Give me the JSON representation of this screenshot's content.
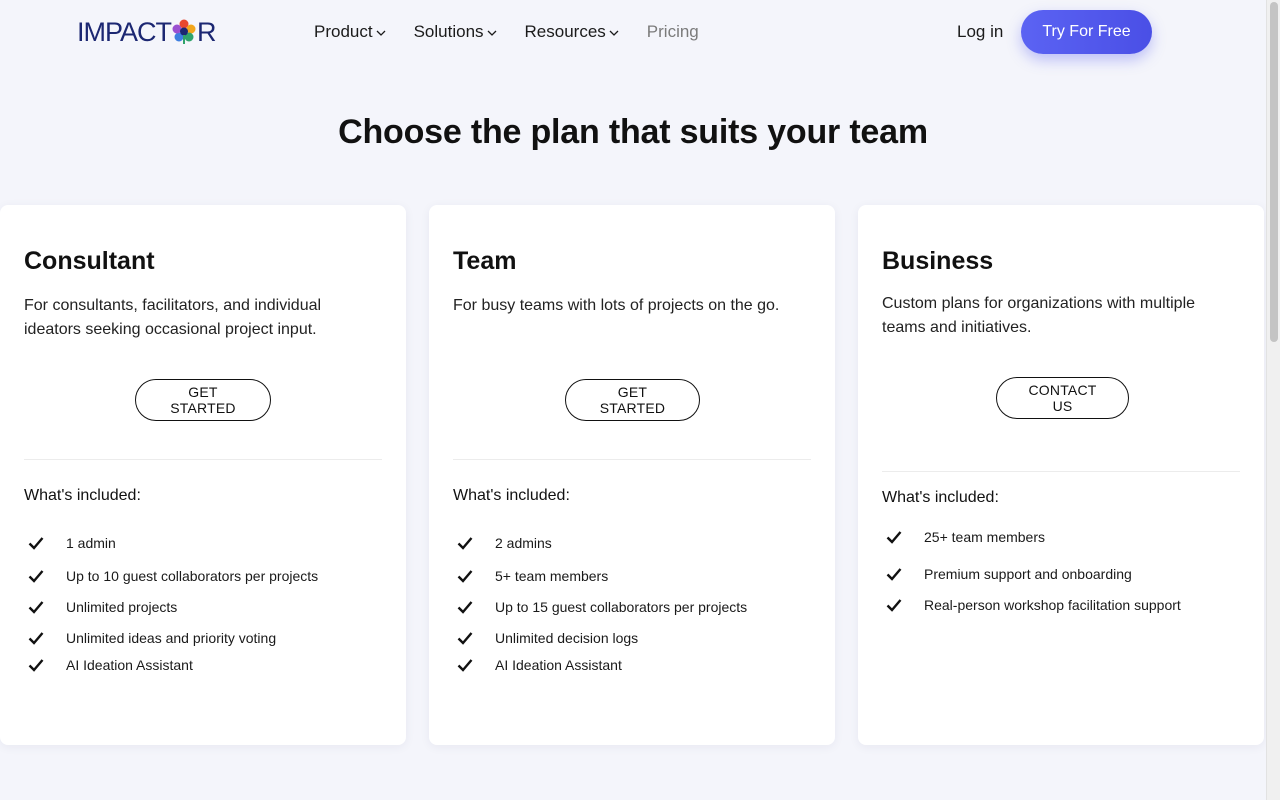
{
  "header": {
    "logo_left": "IMPACT",
    "logo_right": "R",
    "nav": [
      {
        "label": "Product",
        "dropdown": true
      },
      {
        "label": "Solutions",
        "dropdown": true
      },
      {
        "label": "Resources",
        "dropdown": true
      },
      {
        "label": "Pricing",
        "dropdown": false
      }
    ],
    "login_label": "Log in",
    "cta_label": "Try For Free"
  },
  "main": {
    "title": "Choose the plan that suits your team",
    "plans": [
      {
        "name": "Consultant",
        "description": "For consultants, facilitators, and individual ideators seeking occasional project input.",
        "button_label": "GET STARTED",
        "included_label": "What's included:",
        "features": [
          "1 admin",
          "Up to 10 guest collaborators per projects",
          "Unlimited projects",
          "Unlimited ideas and priority voting",
          "AI Ideation Assistant"
        ]
      },
      {
        "name": "Team",
        "description": "For busy teams with lots of projects on the go.",
        "button_label": "GET STARTED",
        "included_label": "What's included:",
        "features": [
          "2 admins",
          "5+ team members",
          "Up to 15 guest collaborators per projects",
          "Unlimited decision logs",
          "AI Ideation Assistant"
        ]
      },
      {
        "name": "Business",
        "description": "Custom plans for organizations with multiple teams and initiatives.",
        "button_label": "CONTACT US",
        "included_label": "What's included:",
        "features": [
          "25+ team members",
          "Premium support and onboarding",
          "Real-person workshop facilitation support"
        ]
      }
    ]
  },
  "colors": {
    "background": "#f4f5fb",
    "brand_navy": "#1c2772",
    "cta": "#5158ee",
    "card": "#ffffff"
  },
  "icons": {
    "nav_dropdown": "chevron-down-icon",
    "feature": "checkmark-icon",
    "logo_mark": "flower-logo-icon"
  }
}
